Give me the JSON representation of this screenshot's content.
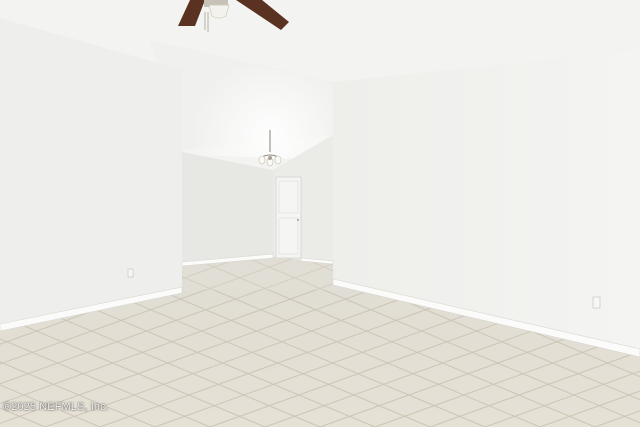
{
  "watermark": {
    "text": "©2025 NEFMLS, Inc."
  },
  "colors": {
    "ceiling": "#f3f3f1",
    "wall_left": "#eeeeec",
    "wall_right": "#f1f1ef",
    "wall_back": "#e8e8e5",
    "floor_tile": "#e2ddd0",
    "grout": "#c9c3b4",
    "baseboard": "#fbfbfa",
    "fan_blade": "#5a3222"
  },
  "icons": [
    "ceiling-fan-icon",
    "chandelier-icon",
    "door-icon",
    "outlet-icon"
  ]
}
